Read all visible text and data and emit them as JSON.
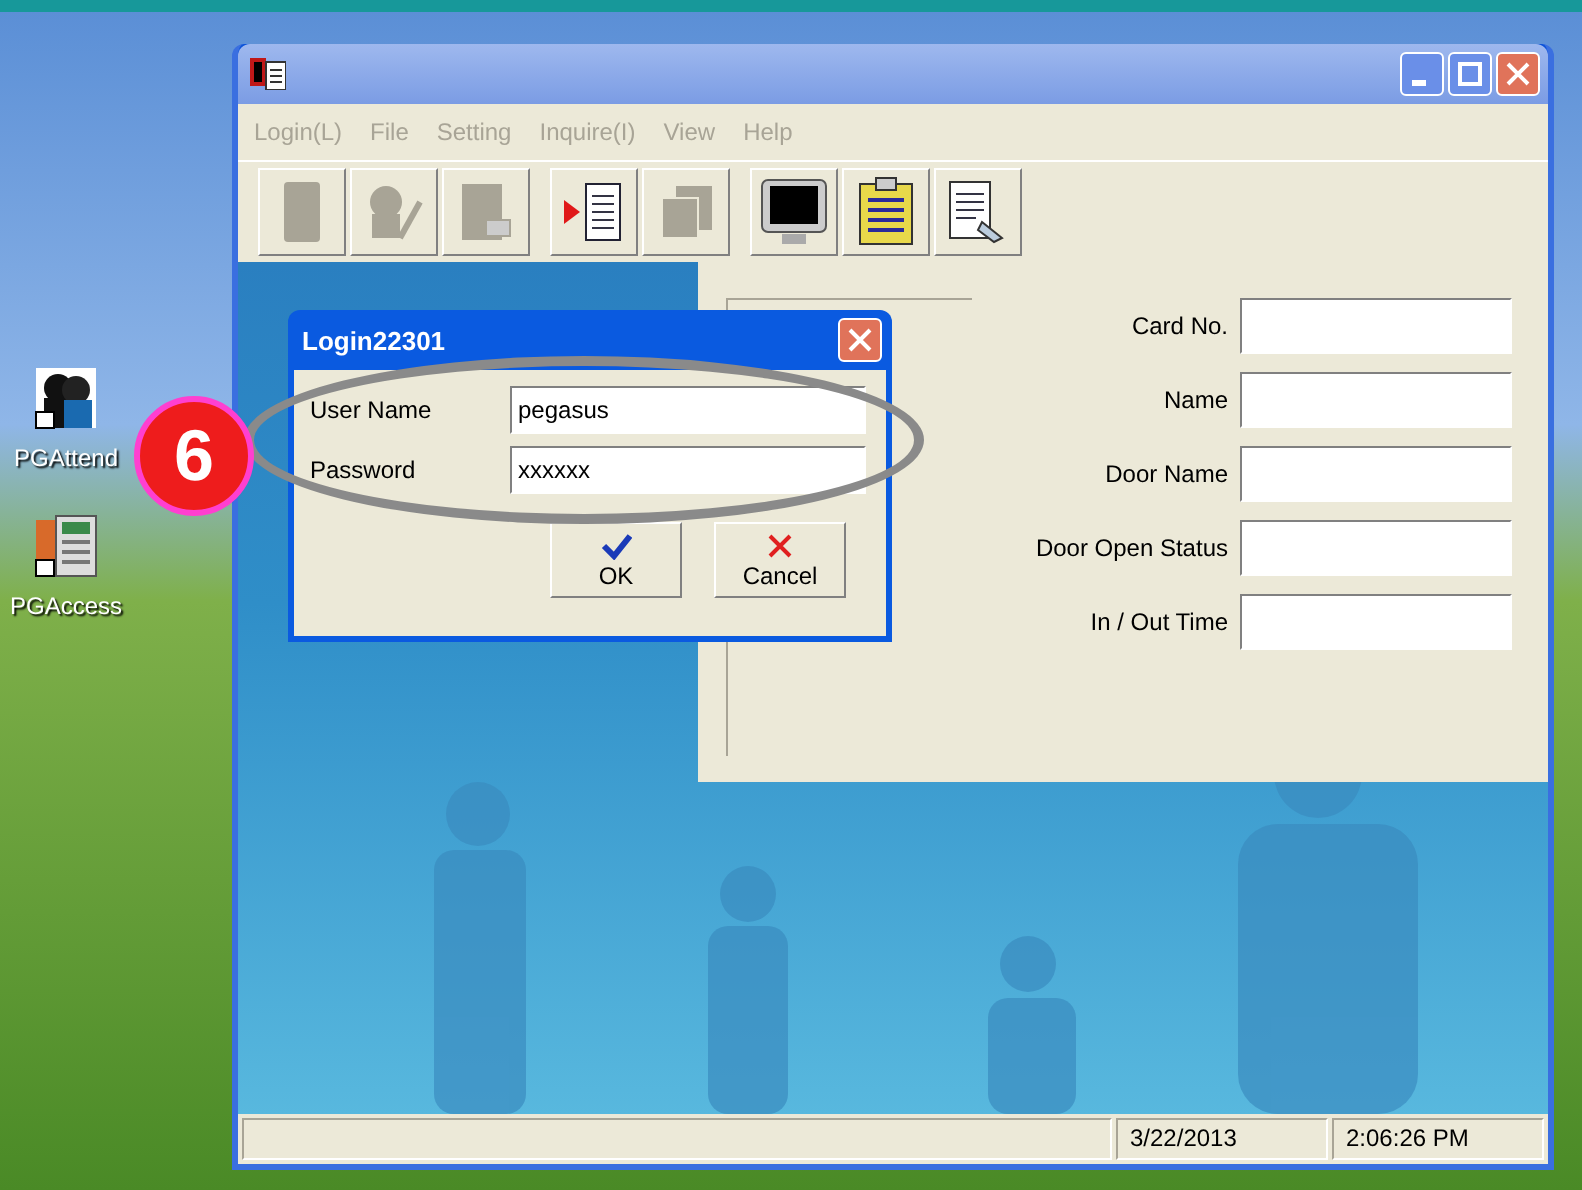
{
  "desktop": {
    "icons": [
      {
        "kind": "attend",
        "label": "PGAttend"
      },
      {
        "kind": "access",
        "label": "PGAccess"
      }
    ]
  },
  "window": {
    "menu": [
      {
        "label": "Login(L)",
        "disabled": true
      },
      {
        "label": "File",
        "disabled": true
      },
      {
        "label": "Setting",
        "disabled": true
      },
      {
        "label": "Inquire(I)",
        "disabled": true
      },
      {
        "label": "View",
        "disabled": true
      },
      {
        "label": "Help",
        "disabled": true
      }
    ],
    "toolbar": [
      {
        "buttons": [
          {
            "kind": "page",
            "disabled": true
          },
          {
            "kind": "person",
            "disabled": true
          },
          {
            "kind": "doc",
            "disabled": true
          }
        ]
      },
      {
        "buttons": [
          {
            "kind": "arrowdoc",
            "disabled": false
          },
          {
            "kind": "stack",
            "disabled": true
          }
        ]
      },
      {
        "buttons": [
          {
            "kind": "monitor",
            "disabled": false
          },
          {
            "kind": "clipboard",
            "disabled": false
          },
          {
            "kind": "report",
            "disabled": false
          }
        ]
      }
    ],
    "fields": [
      {
        "label": "Card No."
      },
      {
        "label": "Name"
      },
      {
        "label": "Door Name"
      },
      {
        "label": "Door Open Status"
      },
      {
        "label": "In / Out Time"
      }
    ],
    "status_bar": [
      "3/22/2013",
      "2:06:26 PM"
    ]
  },
  "dialog": {
    "title": "Login22301",
    "fields": [
      {
        "label": "User Name",
        "value": "pegasus"
      },
      {
        "label": "Password",
        "value": "xxxxxx"
      }
    ],
    "buttons": [
      {
        "kind": "ok",
        "label": "OK"
      },
      {
        "kind": "cancel",
        "label": "Cancel"
      }
    ]
  },
  "annotation": {
    "step": "6"
  }
}
